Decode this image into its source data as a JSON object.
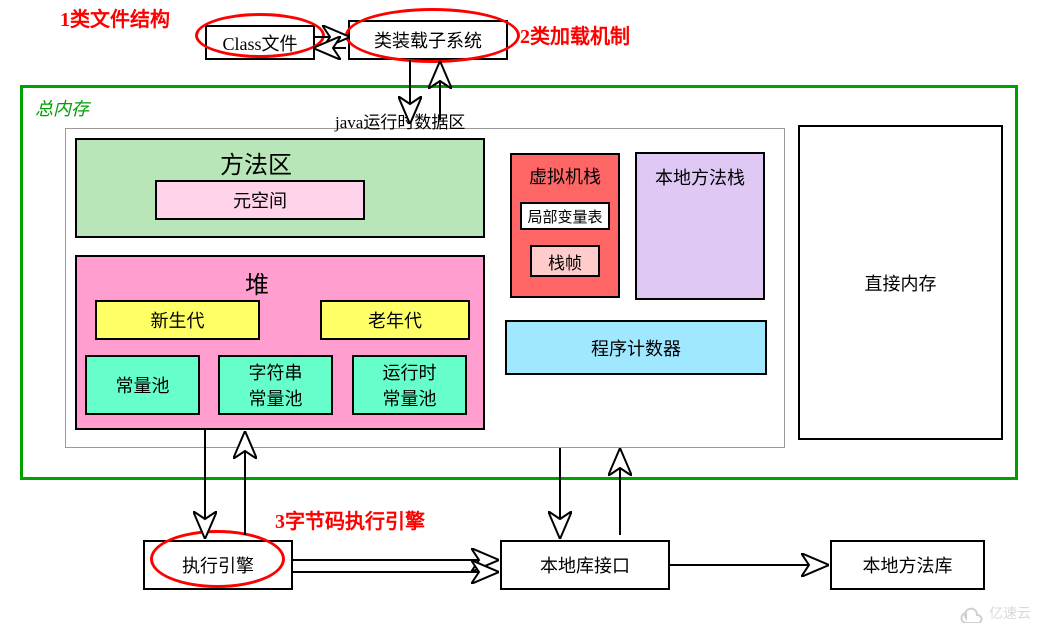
{
  "annotations": {
    "a1": "1类文件结构",
    "a2": "2类加载机制",
    "a3": "3字节码执行引擎"
  },
  "top": {
    "classFile": "Class文件",
    "classLoader": "类装载子系统"
  },
  "memory": {
    "total": "总内存",
    "runtimeArea": "java运行时数据区",
    "methodArea": {
      "title": "方法区",
      "metaspace": "元空间"
    },
    "heap": {
      "title": "堆",
      "newGen": "新生代",
      "oldGen": "老年代",
      "constPool": "常量池",
      "stringPool": "字符串\n常量池",
      "runtimePool": "运行时\n常量池"
    },
    "vmStack": {
      "title": "虚拟机栈",
      "localVars": "局部变量表",
      "stackFrame": "栈帧"
    },
    "nativeStack": "本地方法栈",
    "pc": "程序计数器",
    "directMem": "直接内存"
  },
  "bottom": {
    "execEngine": "执行引擎",
    "nativeLibIf": "本地库接口",
    "nativeLib": "本地方法库"
  },
  "watermark": "亿速云"
}
